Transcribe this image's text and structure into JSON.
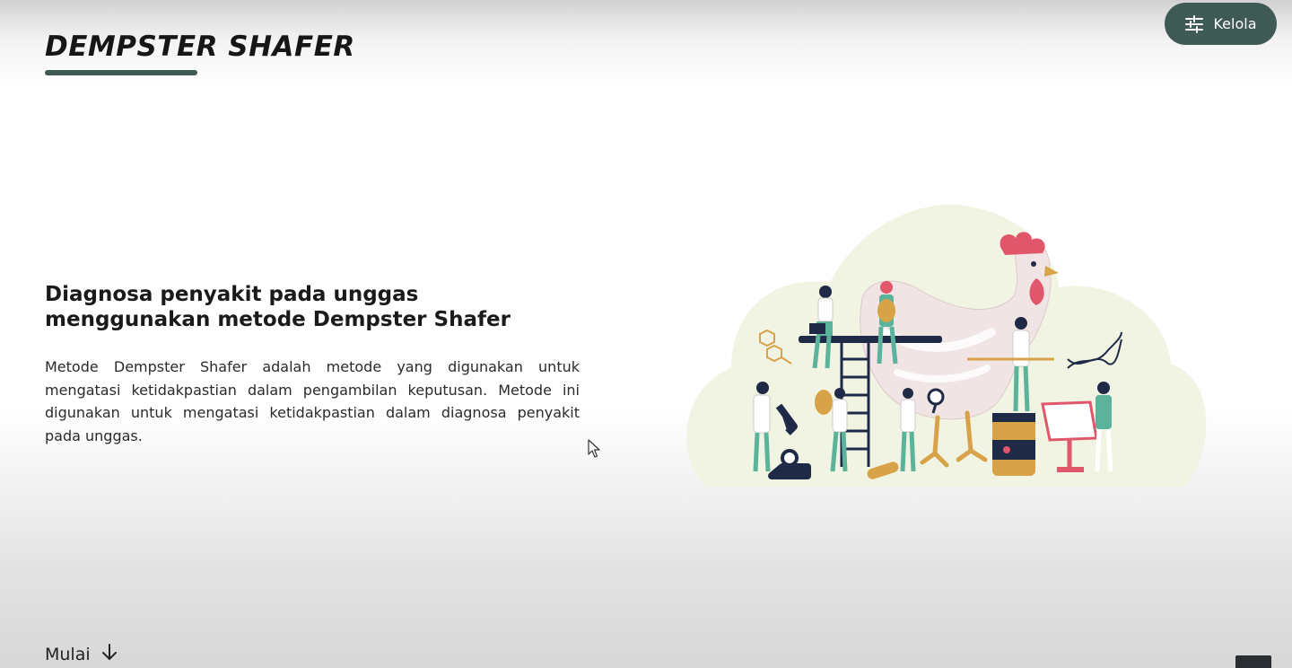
{
  "brand": {
    "title": "DEMPSTER SHAFER"
  },
  "header": {
    "manage_button": {
      "label": "Kelola",
      "icon": "sliders-icon"
    }
  },
  "hero": {
    "title": "Diagnosa penyakit pada unggas menggunakan metode Dempster Shafer",
    "description": "Metode Dempster Shafer adalah metode yang digunakan untuk mengatasi ketidakpastian dalam pengambilan keputusan. Metode ini digunakan untuk mengatasi ketidakpastian dalam diagnosa penyakit pada unggas."
  },
  "start": {
    "label": "Mulai",
    "icon": "arrow-down-icon"
  },
  "colors": {
    "accent": "#3f5a55",
    "illustration_background": "#f1f4e2",
    "chicken_body": "#f1e4e4",
    "comb": "#e0566a",
    "scrubs": "#5bb39c",
    "navy": "#1f2a47",
    "gold": "#d8a348"
  }
}
